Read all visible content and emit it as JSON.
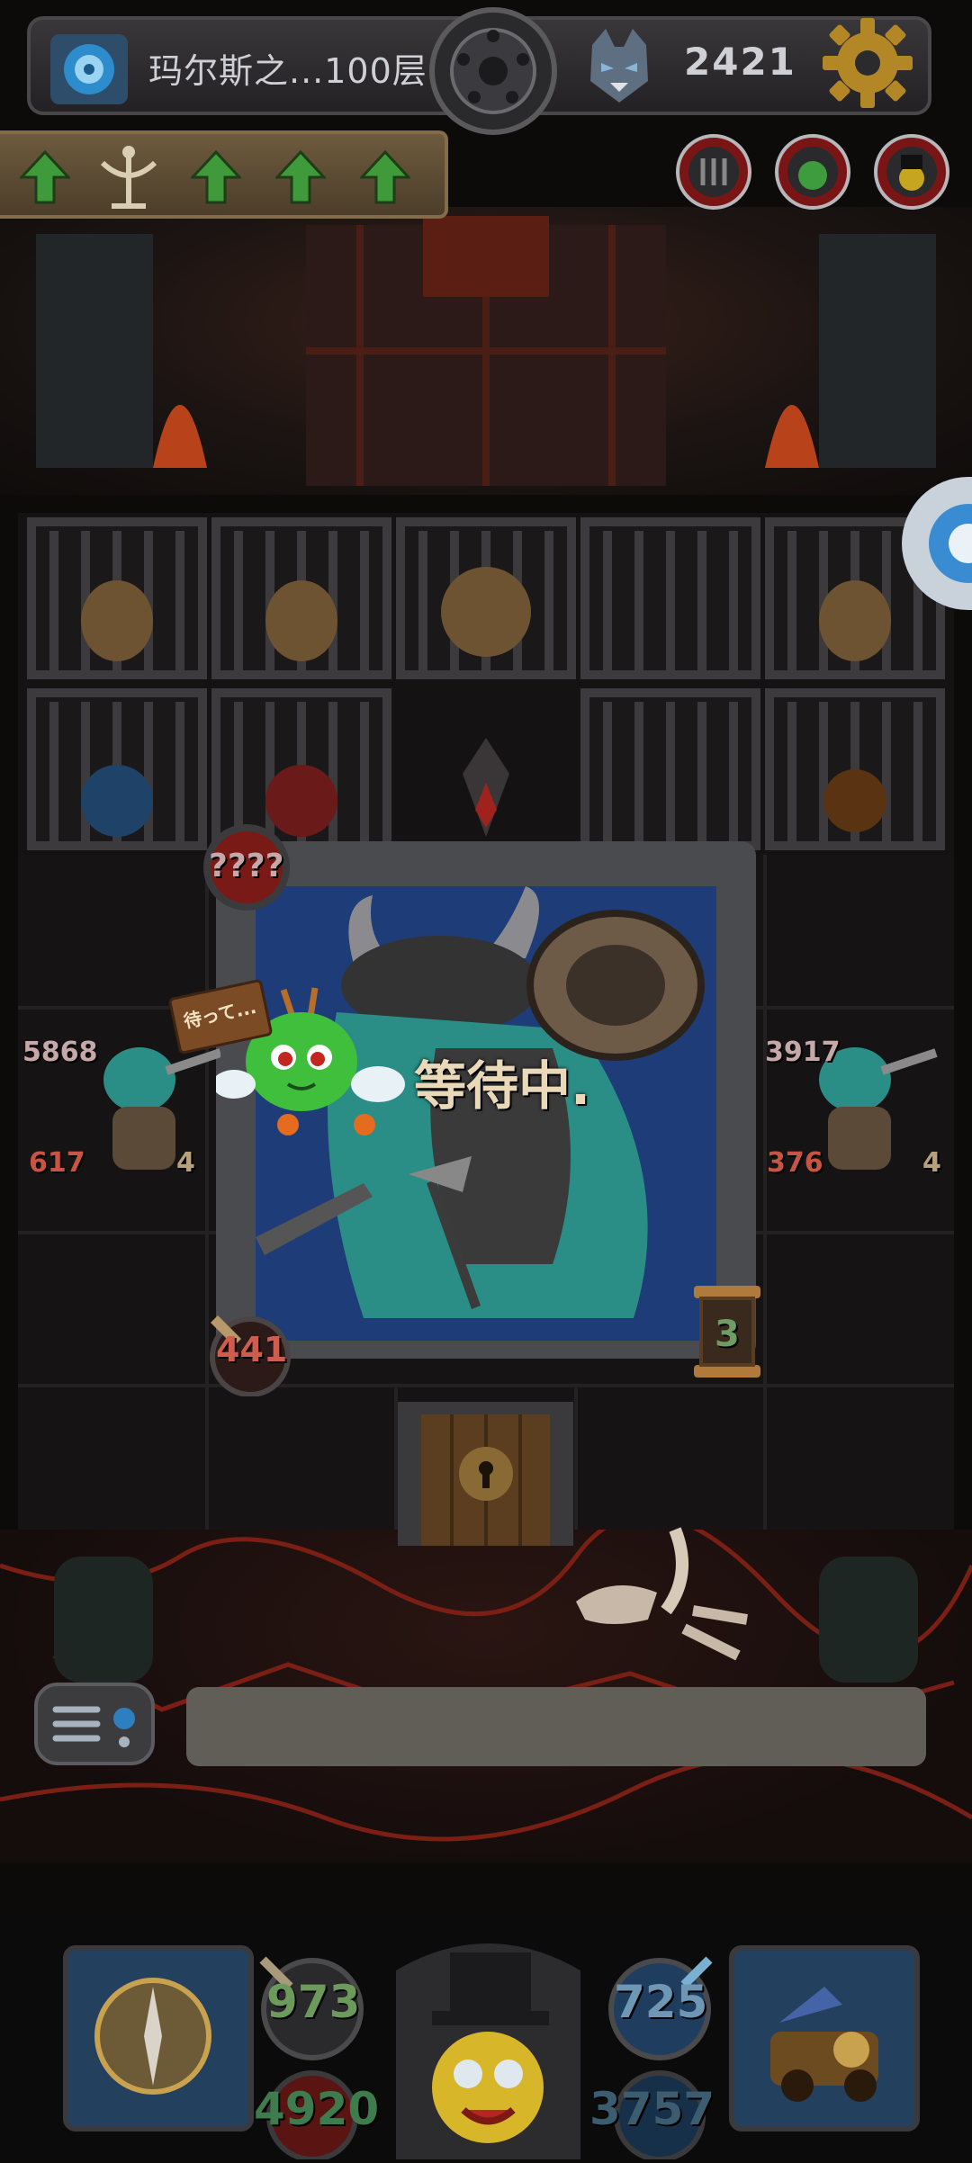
{
  "header": {
    "level_name": "玛尔斯之...100层",
    "gold": "2421"
  },
  "icons": {
    "portal": "portal-icon",
    "medal": "medal-icon",
    "wolf": "wolf-icon",
    "settings": "gear-icon",
    "scepter": "scepter-icon",
    "arrow": "green-up-arrow-icon",
    "chat": "chat-menu-icon"
  },
  "battle": {
    "status_text": "等待中.",
    "mystery_value": "????",
    "attack_value": "441",
    "timer_value": "3",
    "sign_text": "待って..."
  },
  "left_hero": {
    "hp": "5868",
    "attack": "617",
    "level": "4"
  },
  "right_hero": {
    "hp": "3917",
    "attack": "376",
    "level": "4"
  },
  "chat": {
    "value": "",
    "placeholder": ""
  },
  "player_stats": {
    "gold_stat": "973",
    "attack_stat": "4920",
    "defense_stat": "725",
    "mana_stat": "3757"
  },
  "colors": {
    "accent_green": "#3f9a3a",
    "attack_red": "#d05c4e",
    "frame_grey": "#4a4b4f",
    "chat_grey": "#615e58"
  }
}
